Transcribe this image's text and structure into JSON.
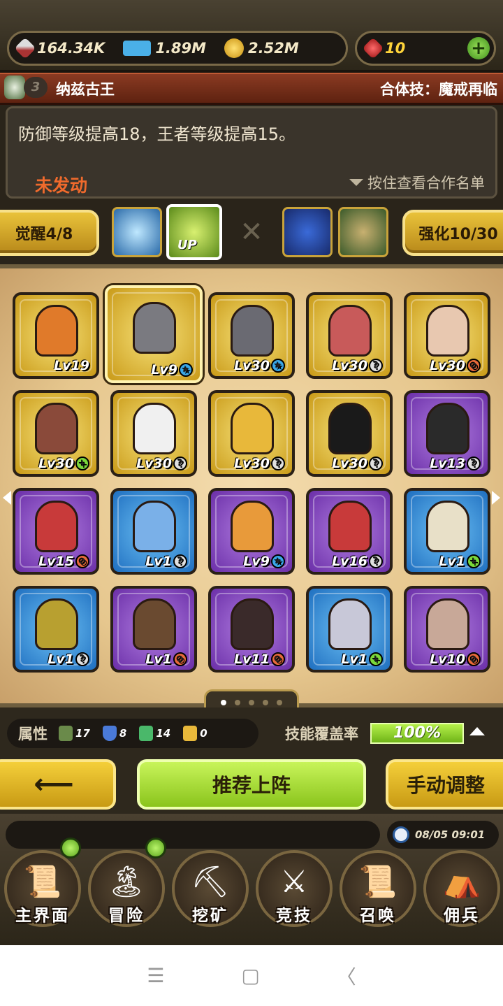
{
  "resources": {
    "power": "164.34K",
    "exp": "1.89M",
    "gold": "2.52M",
    "gems": "10",
    "power_icon": "sword-icon",
    "exp_icon": "exp-icon",
    "gold_icon": "gold-coin-icon",
    "gem_icon": "ruby-icon"
  },
  "header": {
    "level_badge": "3",
    "title": "纳兹古王",
    "combo": "合体技：魔戒再临"
  },
  "description": {
    "text": "防御等级提高18，王者等级提高15。",
    "status": "未发动",
    "hint": "按住查看合作名单"
  },
  "awaken": {
    "awaken_label": "觉醒4/8",
    "enhance_label": "强化10/30",
    "up_label": "UP"
  },
  "heroes": [
    {
      "lv": "Lv19",
      "frame": "gold",
      "mark": "",
      "color": "#e07a2a"
    },
    {
      "lv": "Lv9",
      "frame": "gold",
      "mark": "star",
      "color": "#7a7a80",
      "selected": true
    },
    {
      "lv": "Lv30",
      "frame": "gold",
      "mark": "star",
      "color": "#6a6a72"
    },
    {
      "lv": "Lv30",
      "frame": "gold",
      "mark": "?",
      "color": "#c85a5a"
    },
    {
      "lv": "Lv30",
      "frame": "gold",
      "mark": "x",
      "color": "#e8c8b0"
    },
    {
      "lv": "Lv30",
      "frame": "gold",
      "mark": "+",
      "color": "#8a4a3a"
    },
    {
      "lv": "Lv30",
      "frame": "gold",
      "mark": "?",
      "color": "#f0f0f0"
    },
    {
      "lv": "Lv30",
      "frame": "gold",
      "mark": "?",
      "color": "#e8b83a"
    },
    {
      "lv": "Lv30",
      "frame": "gold",
      "mark": "?",
      "color": "#1a1a1a"
    },
    {
      "lv": "Lv13",
      "frame": "purple",
      "mark": "?",
      "color": "#2a2a2a"
    },
    {
      "lv": "Lv15",
      "frame": "purple",
      "mark": "x",
      "color": "#c83a3a"
    },
    {
      "lv": "Lv1",
      "frame": "blue",
      "mark": "?",
      "color": "#7ab0e8"
    },
    {
      "lv": "Lv9",
      "frame": "purple",
      "mark": "star",
      "color": "#e89a3a"
    },
    {
      "lv": "Lv16",
      "frame": "purple",
      "mark": "?",
      "color": "#c83a3a"
    },
    {
      "lv": "Lv1",
      "frame": "blue",
      "mark": "+",
      "color": "#e8e0c8"
    },
    {
      "lv": "Lv1",
      "frame": "blue",
      "mark": "?",
      "color": "#b8a030"
    },
    {
      "lv": "Lv1",
      "frame": "purple",
      "mark": "x",
      "color": "#6a4a30"
    },
    {
      "lv": "Lv11",
      "frame": "purple",
      "mark": "x",
      "color": "#3a2a2a"
    },
    {
      "lv": "Lv1",
      "frame": "blue",
      "mark": "+",
      "color": "#c8c8d8"
    },
    {
      "lv": "Lv10",
      "frame": "purple",
      "mark": "x",
      "color": "#c8a898"
    }
  ],
  "attributes": {
    "label": "属性",
    "values": [
      "17",
      "8",
      "14",
      "0"
    ],
    "skill_label": "技能覆盖率",
    "skill_rate": "100%"
  },
  "actions": {
    "back": "⟵",
    "recommend": "推荐上阵",
    "manual": "手动调整"
  },
  "clock": "08/05 09:01",
  "nav": [
    {
      "label": "主界面",
      "icon": "scroll-map-icon",
      "glyph": "📜"
    },
    {
      "label": "冒险",
      "icon": "island-icon",
      "glyph": "🏝"
    },
    {
      "label": "挖矿",
      "icon": "pickaxe-icon",
      "glyph": "⛏"
    },
    {
      "label": "竞技",
      "icon": "crossed-swords-icon",
      "glyph": "⚔"
    },
    {
      "label": "召唤",
      "icon": "summon-scroll-icon",
      "glyph": "📜"
    },
    {
      "label": "佣兵",
      "icon": "tent-icon",
      "glyph": "⛺"
    }
  ],
  "system_nav": [
    "☰",
    "▢",
    "〈"
  ]
}
